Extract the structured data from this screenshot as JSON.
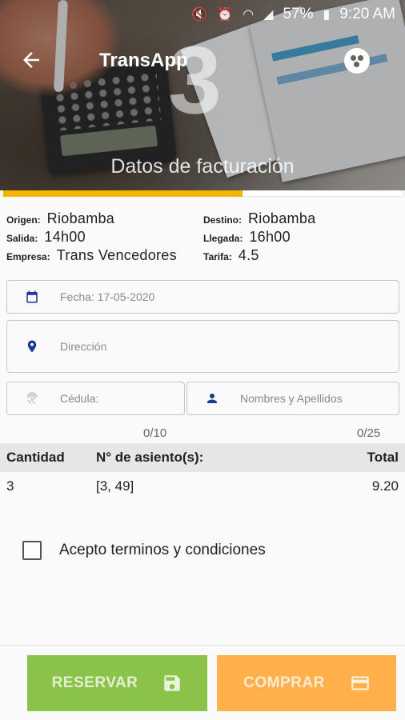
{
  "status_bar": {
    "battery": "57%",
    "time": "9:20 AM"
  },
  "header": {
    "title": "TransApp",
    "step_number": "3",
    "step_title": "Datos de facturación"
  },
  "progress": {
    "fraction": 0.6
  },
  "trip": {
    "origin_label": "Origen:",
    "origin": "Riobamba",
    "destination_label": "Destino:",
    "destination": "Riobamba",
    "departure_label": "Salida:",
    "departure": "14h00",
    "arrival_label": "Llegada:",
    "arrival": "16h00",
    "company_label": "Empresa:",
    "company": "Trans Vencedores",
    "fare_label": "Tarifa:",
    "fare": "4.5"
  },
  "form": {
    "date_placeholder": "Fecha:  17-05-2020",
    "address_placeholder": "Dirección",
    "id_placeholder": "Cédula:",
    "name_placeholder": "Nombres y Apellidos",
    "id_counter": "0/10",
    "name_counter": "0/25"
  },
  "table": {
    "headers": [
      "Cantidad",
      "N° de asiento(s):",
      "Total"
    ],
    "rows": [
      [
        "3",
        "[3, 49]",
        "9.20"
      ]
    ]
  },
  "terms": {
    "label": "Acepto terminos y condiciones",
    "checked": false
  },
  "actions": {
    "reserve_label": "RESERVAR",
    "buy_label": "COMPRAR"
  },
  "colors": {
    "progress": "#f5b400",
    "reserve": "#8bc34a",
    "buy": "#ffb04a",
    "icon_blue": "#1a3a8f"
  }
}
